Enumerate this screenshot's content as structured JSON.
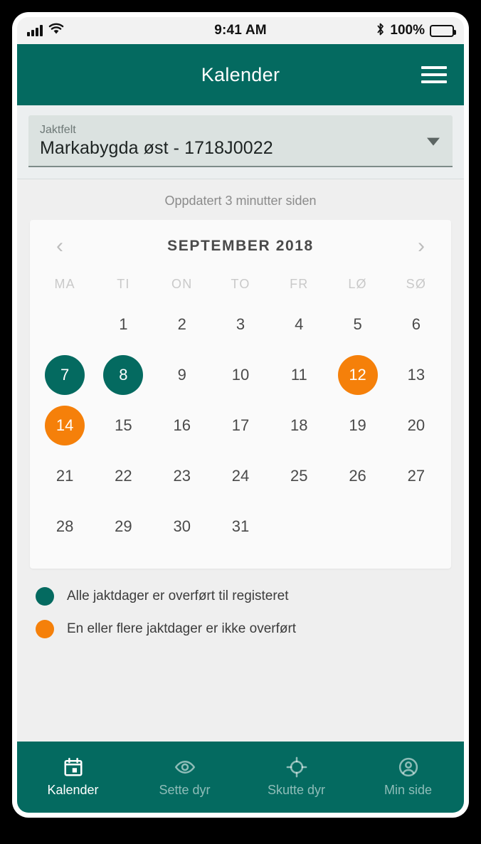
{
  "status_bar": {
    "time": "9:41 AM",
    "battery_percent": "100%",
    "signal_icon": "cellular-signal-icon",
    "wifi_icon": "wifi-icon",
    "bluetooth_icon": "bluetooth-icon",
    "battery_icon": "battery-full-icon"
  },
  "app_bar": {
    "title": "Kalender",
    "menu_icon": "hamburger-menu-icon"
  },
  "selector": {
    "label": "Jaktfelt",
    "value": "Markabygda øst - 1718J0022",
    "caret_icon": "chevron-down-icon"
  },
  "content": {
    "updated_text": "Oppdatert 3 minutter siden"
  },
  "calendar": {
    "month_title": "SEPTEMBER 2018",
    "prev_icon": "chevron-left-icon",
    "next_icon": "chevron-right-icon",
    "weekdays": [
      "MA",
      "TI",
      "ON",
      "TO",
      "FR",
      "LØ",
      "SØ"
    ],
    "leading_blanks": 1,
    "days": [
      {
        "n": "1",
        "state": "none"
      },
      {
        "n": "2",
        "state": "none"
      },
      {
        "n": "3",
        "state": "none"
      },
      {
        "n": "4",
        "state": "none"
      },
      {
        "n": "5",
        "state": "none"
      },
      {
        "n": "6",
        "state": "none"
      },
      {
        "n": "7",
        "state": "done"
      },
      {
        "n": "8",
        "state": "done"
      },
      {
        "n": "9",
        "state": "none"
      },
      {
        "n": "10",
        "state": "none"
      },
      {
        "n": "11",
        "state": "none"
      },
      {
        "n": "12",
        "state": "pending"
      },
      {
        "n": "13",
        "state": "none"
      },
      {
        "n": "14",
        "state": "pending"
      },
      {
        "n": "15",
        "state": "none"
      },
      {
        "n": "16",
        "state": "none"
      },
      {
        "n": "17",
        "state": "none"
      },
      {
        "n": "18",
        "state": "none"
      },
      {
        "n": "19",
        "state": "none"
      },
      {
        "n": "20",
        "state": "none"
      },
      {
        "n": "21",
        "state": "none"
      },
      {
        "n": "22",
        "state": "none"
      },
      {
        "n": "23",
        "state": "none"
      },
      {
        "n": "24",
        "state": "none"
      },
      {
        "n": "25",
        "state": "none"
      },
      {
        "n": "26",
        "state": "none"
      },
      {
        "n": "27",
        "state": "none"
      },
      {
        "n": "28",
        "state": "none"
      },
      {
        "n": "29",
        "state": "none"
      },
      {
        "n": "30",
        "state": "none"
      },
      {
        "n": "31",
        "state": "none"
      }
    ]
  },
  "legend": [
    {
      "color": "#046a60",
      "text": "Alle jaktdager er overført til registeret"
    },
    {
      "color": "#f5800a",
      "text": "En eller flere jaktdager er ikke overført"
    }
  ],
  "tabs": [
    {
      "label": "Kalender",
      "icon": "calendar-icon",
      "active": true
    },
    {
      "label": "Sette dyr",
      "icon": "eye-icon",
      "active": false
    },
    {
      "label": "Skutte dyr",
      "icon": "crosshair-icon",
      "active": false
    },
    {
      "label": "Min side",
      "icon": "person-icon",
      "active": false
    }
  ],
  "colors": {
    "brand_teal": "#046a60",
    "accent_orange": "#f5800a",
    "page_background": "#efefef",
    "card_background": "#fafafa",
    "selector_background": "#dbe2e0"
  }
}
